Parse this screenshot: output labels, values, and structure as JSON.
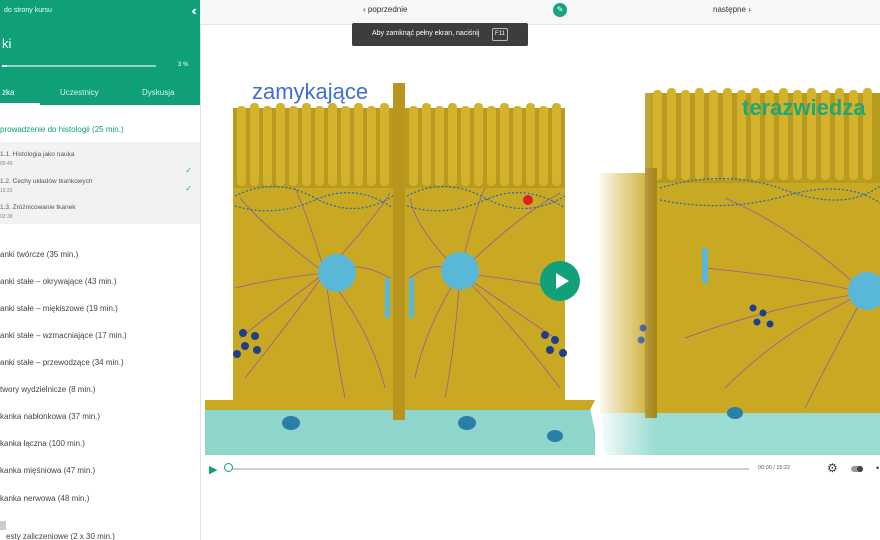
{
  "sidebar": {
    "back_link": "do strony kursu",
    "collapse_icon": "double-chevron-left-icon",
    "course_title": "ki",
    "progress_label": "3 %",
    "progress": 0.03,
    "tabs": [
      {
        "label": "zka",
        "active": true
      },
      {
        "label": "Uczestnicy",
        "active": false
      },
      {
        "label": "Dyskusja",
        "active": false
      }
    ],
    "open_section": "prowadzenie do histologii (25 min.)",
    "lessons": [
      {
        "title": "1.1. Histologia jako nauka",
        "time": "05:49",
        "done": true
      },
      {
        "title": "1.2. Cechy układów tkankowych",
        "time": "15:22",
        "done": true
      },
      {
        "title": "1.3. Zróżnicowanie tkanek",
        "time": "02:38",
        "done": false
      }
    ],
    "sections": [
      "anki twórcze (35 min.)",
      "anki stałe – okrywające (43 min.)",
      "anki stałe – miękiszowe (19 min.)",
      "anki stałe – wzmacniające (17 min.)",
      "anki stałe – przewodzące (34 min.)",
      "twory wydzielnicze (8 min.)",
      "kanka nabłonkowa (37 min.)",
      "kanka łączna (100 min.)",
      "kanka mięśniowa (47 min.)",
      "kanka nerwowa (48 min.)",
      "esty zaliczeniowe (2 x 30 min.)"
    ]
  },
  "topbar": {
    "prev": "‹ poprzednie",
    "next": "następne ›",
    "edit_icon": "pencil-icon"
  },
  "toast": {
    "text": "Aby zamknąć pełny ekran, naciśnij",
    "key": "F11"
  },
  "video": {
    "title_left": "zamykające",
    "title_right": "terazwiedza",
    "time": "00:00 / 15:22",
    "progress": 0.0
  },
  "colors": {
    "accent": "#0fa07a",
    "cell_yellow": "#c9a823",
    "nucleus": "#59b7d8",
    "fiber": "#8a4fb4",
    "base_teal": "#8ed5cc"
  }
}
